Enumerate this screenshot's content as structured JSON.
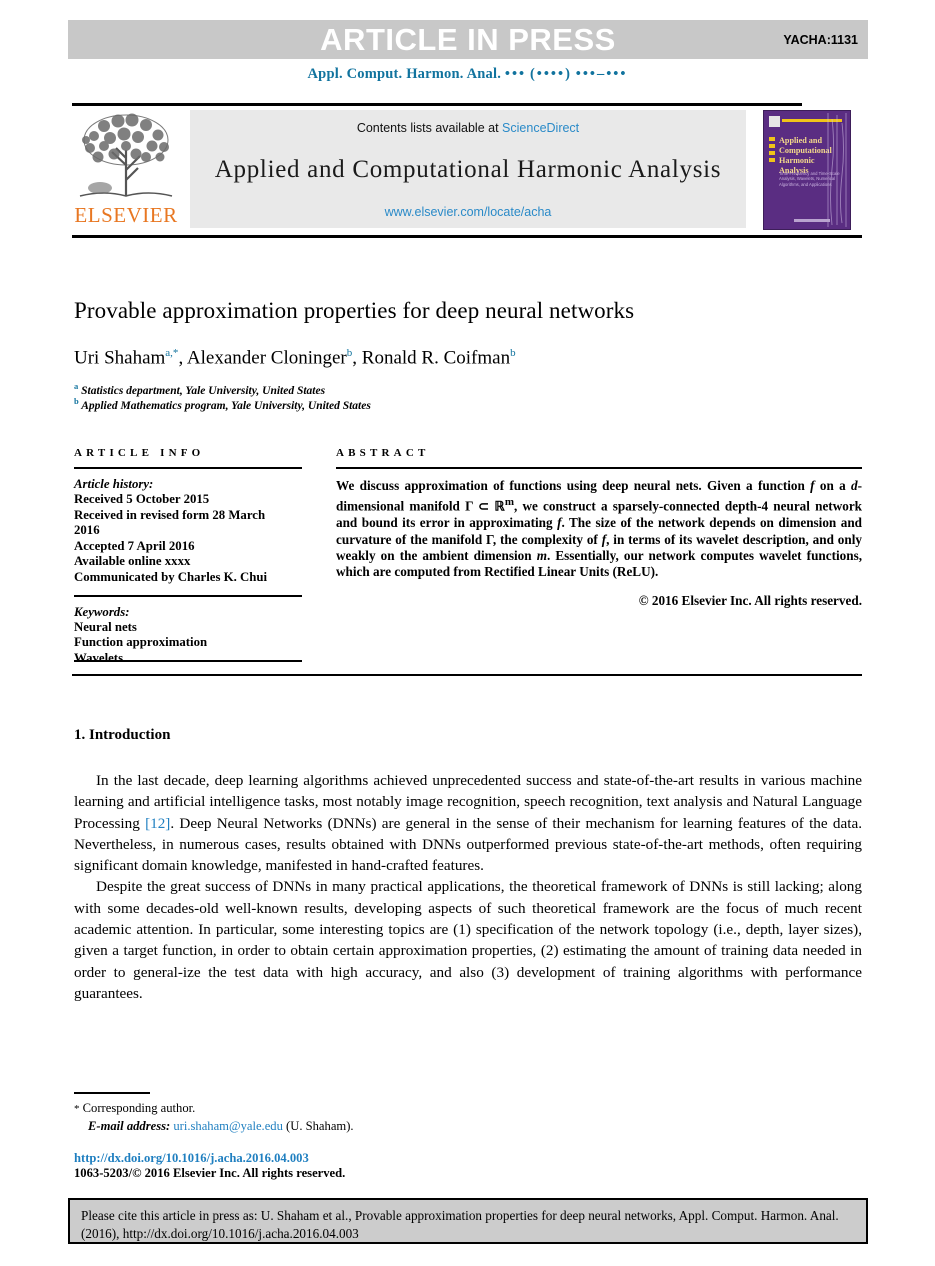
{
  "banner": {
    "press_label": "ARTICLE IN PRESS",
    "article_code": "YACHA:1131",
    "bg_color": "#c8c8c8"
  },
  "running_head": {
    "journal_abbrev": "Appl. Comput. Harmon. Anal.",
    "volume_dots": "•••",
    "year_dots": "(••••)",
    "page_dots": "•••–•••",
    "color": "#11739e"
  },
  "masthead": {
    "publisher_name": "ELSEVIER",
    "publisher_color": "#e87722",
    "contents_prefix": "Contents lists available at",
    "contents_link": "ScienceDirect",
    "journal_title": "Applied and Computational Harmonic Analysis",
    "journal_url": "www.elsevier.com/locate/acha",
    "link_color": "#2a8ac8",
    "cover": {
      "title_line1": "Applied and",
      "title_line2": "Computational",
      "title_line3": "Harmonic Analysis",
      "subtitle": "Time-Frequency and Time-Scale Analysis, Wavelets, Numerical Algorithms, and Applications",
      "bg_color": "#5a2d82",
      "accent_color": "#f0c419"
    }
  },
  "article": {
    "title": "Provable approximation properties for deep neural networks",
    "authors": [
      {
        "name": "Uri Shaham",
        "marks": "a,*"
      },
      {
        "name": "Alexander Cloninger",
        "marks": "b"
      },
      {
        "name": "Ronald R. Coifman",
        "marks": "b"
      }
    ],
    "authors_separator": ", ",
    "affiliations": [
      {
        "mark": "a",
        "text": "Statistics department, Yale University, United States"
      },
      {
        "mark": "b",
        "text": "Applied Mathematics program, Yale University, United States"
      }
    ]
  },
  "article_info": {
    "heading": "ARTICLE INFO",
    "history_label": "Article history:",
    "history": [
      "Received 5 October 2015",
      "Received in revised form 28 March",
      "2016",
      "Accepted 7 April 2016",
      "Available online xxxx",
      "Communicated by Charles K. Chui"
    ],
    "keywords_label": "Keywords:",
    "keywords": [
      "Neural nets",
      "Function approximation",
      "Wavelets"
    ]
  },
  "abstract": {
    "heading": "ABSTRACT",
    "text_part1": "We discuss approximation of functions using deep neural nets. Given a function ",
    "f1": "f",
    "text_part2": " on a ",
    "d": "d",
    "text_part3": "-dimensional manifold Γ ⊂ ℝ",
    "m_sup": "m",
    "text_part4": ", we construct a sparsely-connected depth-4 neural network and bound its error in approximating ",
    "f2": "f",
    "text_part5": ". The size of the network depends on dimension and curvature of the manifold Γ, the complexity of ",
    "f3": "f",
    "text_part6": ", in terms of its wavelet description, and only weakly on the ambient dimension ",
    "m": "m",
    "text_part7": ". Essentially, our network computes wavelet functions, which are computed from Rectified Linear Units (ReLU).",
    "copyright": "© 2016 Elsevier Inc. All rights reserved."
  },
  "body": {
    "section_heading": "1. Introduction",
    "paragraph1_a": "In the last decade, deep learning algorithms achieved unprecedented success and state-of-the-art results in various machine learning and artificial intelligence tasks, most notably image recognition, speech recognition, text analysis and Natural Language Processing ",
    "citation1": "[12]",
    "paragraph1_b": ". Deep Neural Networks (DNNs) are general in the sense of their mechanism for learning features of the data. Nevertheless, in numerous cases, results obtained with DNNs outperformed previous state-of-the-art methods, often requiring significant domain knowledge, manifested in hand-crafted features.",
    "paragraph2": "Despite the great success of DNNs in many practical applications, the theoretical framework of DNNs is still lacking; along with some decades-old well-known results, developing aspects of such theoretical framework are the focus of much recent academic attention. In particular, some interesting topics are (1) specification of the network topology (i.e., depth, layer sizes), given a target function, in order to obtain certain approximation properties, (2) estimating the amount of training data needed in order to general-ize the test data with high accuracy, and also (3) development of training algorithms with performance guarantees."
  },
  "footnotes": {
    "star": "*",
    "corresponding": "Corresponding author.",
    "email_label": "E-mail address:",
    "email": "uri.shaham@yale.edu",
    "email_suffix": "(U. Shaham).",
    "doi_url": "http://dx.doi.org/10.1016/j.acha.2016.04.003",
    "issn_line": "1063-5203/© 2016 Elsevier Inc. All rights reserved.",
    "link_color": "#1f7fc0"
  },
  "cite_box": {
    "text": "Please cite this article in press as: U. Shaham et al., Provable approximation properties for deep neural networks, Appl. Comput. Harmon. Anal. (2016), http://dx.doi.org/10.1016/j.acha.2016.04.003",
    "bg_color": "#cccccc"
  }
}
